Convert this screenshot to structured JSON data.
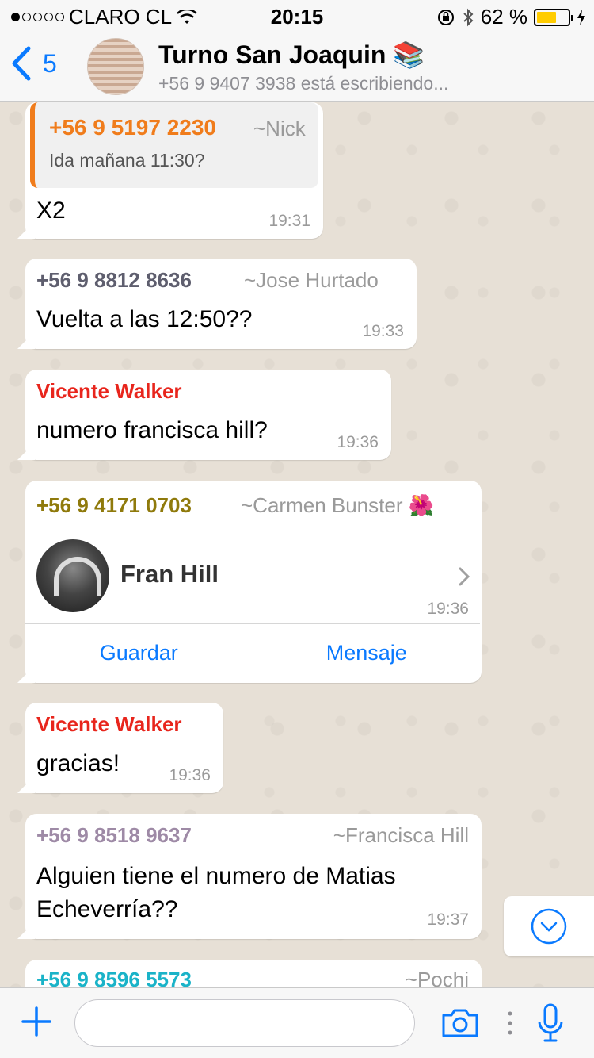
{
  "status_bar": {
    "carrier": "CLARO CL",
    "time": "20:15",
    "battery_percent": "62 %",
    "battery_level": 0.62,
    "signal_bars_filled": 1,
    "signal_bars_total": 5
  },
  "header": {
    "back_count": "5",
    "title": "Turno San Joaquin 📚",
    "subtitle": "+56 9 9407 3938 está escribiendo..."
  },
  "messages": [
    {
      "quote_name": "+56 9 5197 2230",
      "quote_alias": "~Nick",
      "quote_text": "Ida mañana 11:30?",
      "text": "X2",
      "time": "19:31"
    },
    {
      "sender": "+56 9 8812 8636",
      "alias": "~Jose Hurtado",
      "text": "Vuelta a las 12:50??",
      "time": "19:33"
    },
    {
      "sender": "Vicente Walker",
      "text": "numero francisca hill?",
      "time": "19:36"
    },
    {
      "sender": "+56 9 4171 0703",
      "alias": "~Carmen Bunster 🌺",
      "contact_name": "Fran Hill",
      "time": "19:36",
      "save_label": "Guardar",
      "message_label": "Mensaje"
    },
    {
      "sender": "Vicente Walker",
      "text": "gracias!",
      "time": "19:36"
    },
    {
      "sender": "+56 9 8518 9637",
      "alias": "~Francisca Hill",
      "text_line1": "Alguien tiene el numero de Matias",
      "text_line2": "Echeverría??",
      "time": "19:37"
    },
    {
      "sender": "+56 9 8596 5573",
      "alias": "~Pochi"
    }
  ],
  "input": {
    "placeholder": "",
    "value": ""
  },
  "colors": {
    "accent": "#0a7aff",
    "orange_sender": "#f07c1b",
    "gray_sender": "#5e5e6e",
    "red_sender": "#e8251c",
    "olive_sender": "#8f7a0c",
    "mauve_sender": "#9e8aa6",
    "teal_sender": "#1ab3c8"
  }
}
